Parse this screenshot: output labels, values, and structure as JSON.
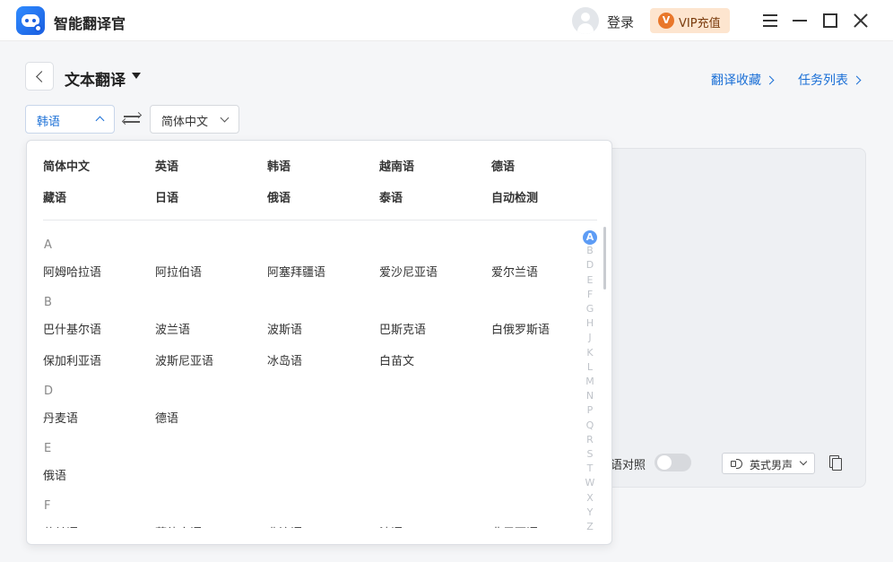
{
  "app": {
    "title": "智能翻译官"
  },
  "titlebar": {
    "login": "登录",
    "vip": "VIP充值",
    "vip_icon_letter": "V"
  },
  "header": {
    "title": "文本翻译",
    "favorites": "翻译收藏",
    "tasks": "任务列表"
  },
  "source_lang": "韩语",
  "target_lang": "简体中文",
  "output": {
    "bilingual": "语对照",
    "voice": "英式男声"
  },
  "common_languages": [
    "简体中文",
    "英语",
    "韩语",
    "越南语",
    "德语",
    "藏语",
    "日语",
    "俄语",
    "泰语",
    "自动检测"
  ],
  "groups": [
    {
      "letter": "A",
      "items": [
        "阿姆哈拉语",
        "阿拉伯语",
        "阿塞拜疆语",
        "爱沙尼亚语",
        "爱尔兰语"
      ]
    },
    {
      "letter": "B",
      "items": [
        "巴什基尔语",
        "波兰语",
        "波斯语",
        "巴斯克语",
        "白俄罗斯语",
        "保加利亚语",
        "波斯尼亚语",
        "冰岛语",
        "白苗文"
      ]
    },
    {
      "letter": "D",
      "items": [
        "丹麦语",
        "德语"
      ]
    },
    {
      "letter": "E",
      "items": [
        "俄语"
      ]
    },
    {
      "letter": "F",
      "items": [
        "芬兰语",
        "菲律宾语",
        "斐济语",
        "法语",
        "弗里西语"
      ]
    }
  ],
  "alphabet": [
    "A",
    "B",
    "D",
    "E",
    "F",
    "G",
    "H",
    "J",
    "K",
    "L",
    "M",
    "N",
    "P",
    "Q",
    "R",
    "S",
    "T",
    "W",
    "X",
    "Y",
    "Z"
  ],
  "active_letter": "A",
  "colors": {
    "accent": "#1a6fd6",
    "vip_bg": "#fde5cf",
    "vip_icon": "#e9772a",
    "index_active": "#5d9cf5"
  },
  "icons": [
    "app-logo-icon",
    "avatar-icon",
    "vip-icon",
    "menu-icon",
    "minimize-icon",
    "maximize-icon",
    "close-icon",
    "back-icon",
    "caret-down-icon",
    "chevron-right-icon",
    "swap-icon",
    "speaker-icon",
    "copy-icon"
  ]
}
